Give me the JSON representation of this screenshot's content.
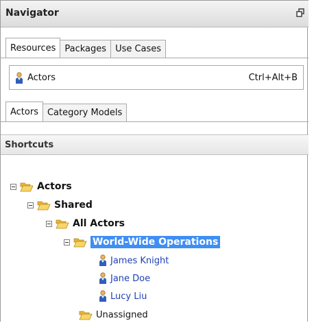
{
  "panel": {
    "title": "Navigator",
    "restore_icon": "restore-icon"
  },
  "top_tabs": [
    {
      "label": "Resources",
      "active": true
    },
    {
      "label": "Packages",
      "active": false
    },
    {
      "label": "Use Cases",
      "active": false
    }
  ],
  "menu_item": {
    "icon": "actor-icon",
    "label": "Actors",
    "shortcut": "Ctrl+Alt+B"
  },
  "sub_tabs": [
    {
      "label": "Actors",
      "active": true
    },
    {
      "label": "Category Models",
      "active": false
    }
  ],
  "shortcuts": {
    "title": "Shortcuts"
  },
  "tree": {
    "root": "Actors",
    "shared": "Shared",
    "all_actors": "All Actors",
    "selected_folder": "World-Wide Operations",
    "actors": [
      "James Knight",
      "Jane Doe",
      "Lucy Liu"
    ],
    "unassigned": "Unassigned"
  },
  "colors": {
    "selection": "#3f8ef4",
    "link": "#1f3fb5",
    "folder": "#f2c94c"
  }
}
